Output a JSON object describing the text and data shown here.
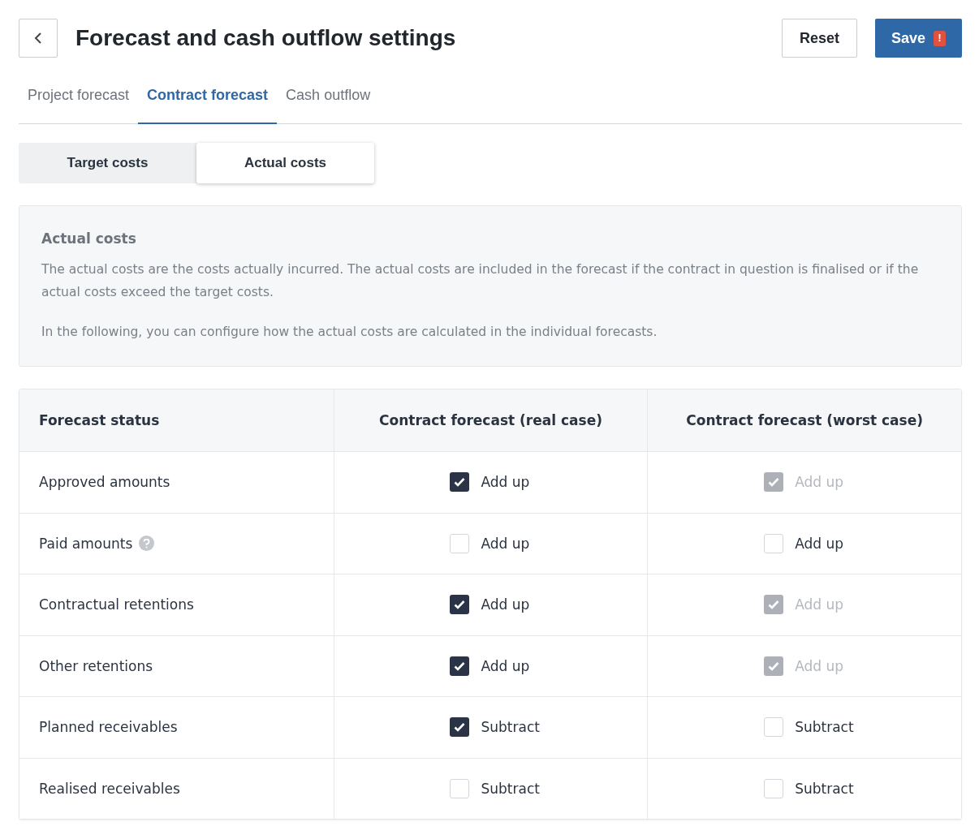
{
  "header": {
    "title": "Forecast and cash outflow settings",
    "reset_label": "Reset",
    "save_label": "Save",
    "save_badge": "!"
  },
  "tabs": [
    {
      "label": "Project forecast",
      "selected": false
    },
    {
      "label": "Contract forecast",
      "selected": true
    },
    {
      "label": "Cash outflow",
      "selected": false
    }
  ],
  "segments": [
    {
      "label": "Target costs",
      "selected": false
    },
    {
      "label": "Actual costs",
      "selected": true
    }
  ],
  "info": {
    "title": "Actual costs",
    "paragraphs": [
      "The actual costs are the costs actually incurred. The actual costs are included in the forecast if the contract in question is finalised or if the actual costs exceed the target costs.",
      "In the following, you can configure how the actual costs are calculated in the individual forecasts."
    ]
  },
  "table": {
    "columns": [
      "Forecast status",
      "Contract forecast (real case)",
      "Contract forecast (worst case)"
    ],
    "rows": [
      {
        "cells": [
          {
            "kind": "status",
            "label": "Approved amounts"
          },
          {
            "kind": "check",
            "label": "Add up",
            "checked": true,
            "disabled": false
          },
          {
            "kind": "check",
            "label": "Add up",
            "checked": true,
            "disabled": true
          }
        ]
      },
      {
        "cells": [
          {
            "kind": "status",
            "label": "Paid amounts",
            "help": true
          },
          {
            "kind": "check",
            "label": "Add up",
            "checked": false,
            "disabled": false
          },
          {
            "kind": "check",
            "label": "Add up",
            "checked": false,
            "disabled": false
          }
        ]
      },
      {
        "cells": [
          {
            "kind": "status",
            "label": "Contractual retentions"
          },
          {
            "kind": "check",
            "label": "Add up",
            "checked": true,
            "disabled": false
          },
          {
            "kind": "check",
            "label": "Add up",
            "checked": true,
            "disabled": true
          }
        ]
      },
      {
        "cells": [
          {
            "kind": "status",
            "label": "Other retentions"
          },
          {
            "kind": "check",
            "label": "Add up",
            "checked": true,
            "disabled": false
          },
          {
            "kind": "check",
            "label": "Add up",
            "checked": true,
            "disabled": true
          }
        ]
      },
      {
        "cells": [
          {
            "kind": "status",
            "label": "Planned receivables"
          },
          {
            "kind": "check",
            "label": "Subtract",
            "checked": true,
            "disabled": false
          },
          {
            "kind": "check",
            "label": "Subtract",
            "checked": false,
            "disabled": false
          }
        ]
      },
      {
        "cells": [
          {
            "kind": "status",
            "label": "Realised receivables"
          },
          {
            "kind": "check",
            "label": "Subtract",
            "checked": false,
            "disabled": false
          },
          {
            "kind": "check",
            "label": "Subtract",
            "checked": false,
            "disabled": false
          }
        ]
      }
    ]
  }
}
